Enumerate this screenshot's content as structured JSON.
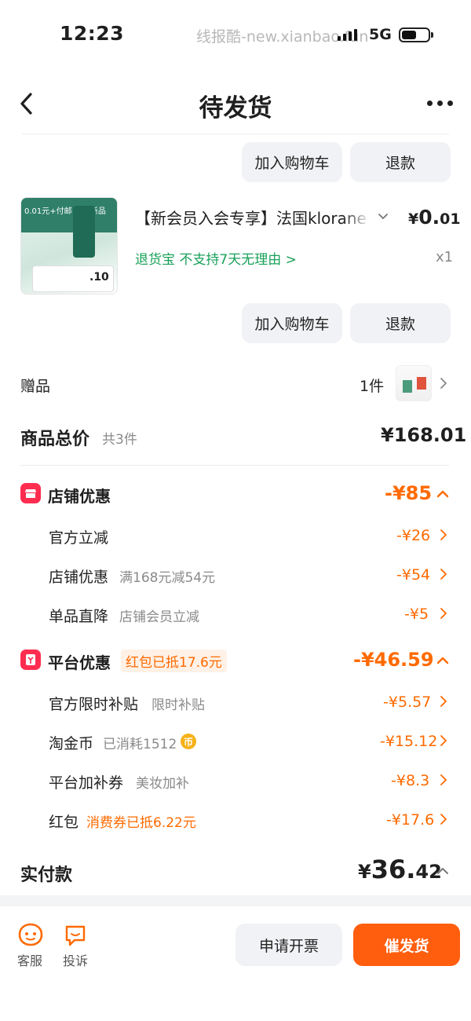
{
  "status_bar": {
    "time": "12:23",
    "watermark": "线报酷-new.xianbao.fun",
    "network": "5G"
  },
  "nav": {
    "title": "待发货"
  },
  "item1_actions": {
    "add_cart": "加入购物车",
    "refund": "退款"
  },
  "product": {
    "image_banner": "0.01元+付邮 体验新品",
    "image_card_price": ".10",
    "title": "【新会员入会专享】法国klorane",
    "price_symbol": "¥",
    "price_int": "0.",
    "price_dec": "01",
    "service": "退货宝  不支持7天无理由 >",
    "quantity": "x1"
  },
  "item2_actions": {
    "add_cart": "加入购物车",
    "refund": "退款"
  },
  "gift": {
    "label": "赠品",
    "count": "1件"
  },
  "summary": {
    "title": "商品总价",
    "count": "共3件",
    "total": "¥168.01"
  },
  "store_discount": {
    "title": "店铺优惠",
    "amount": "-¥85",
    "rows": [
      {
        "label": "官方立减",
        "sub": "",
        "amount": "-¥26"
      },
      {
        "label": "店铺优惠",
        "sub": "满168元减54元",
        "amount": "-¥54"
      },
      {
        "label": "单品直降",
        "sub": "店铺会员立减",
        "amount": "-¥5"
      }
    ]
  },
  "platform_discount": {
    "title": "平台优惠",
    "badge": "红包已抵17.6元",
    "amount": "-¥46.59",
    "rows": [
      {
        "label": "官方限时补贴",
        "sub": "限时补贴",
        "amount": "-¥5.57"
      },
      {
        "label": "淘金币",
        "sub": "已消耗1512",
        "amount": "-¥15.12"
      },
      {
        "label": "平台加补券",
        "sub": "美妆加补",
        "amount": "-¥8.3"
      },
      {
        "label": "红包",
        "sub": "消费券已抵6.22元",
        "amount": "-¥17.6"
      }
    ]
  },
  "payment": {
    "label": "实付款",
    "symbol": "¥",
    "int": "36.",
    "dec": "42"
  },
  "bottom_bar": {
    "service": "客服",
    "complaint": "投诉",
    "invoice_button": "申请开票",
    "urge_button": "催发货"
  },
  "colors": {
    "accent": "#ff6a00",
    "primary_button": "#ff5e0e",
    "service_green": "#19a15a",
    "icon_red": "#ff2d4f"
  }
}
